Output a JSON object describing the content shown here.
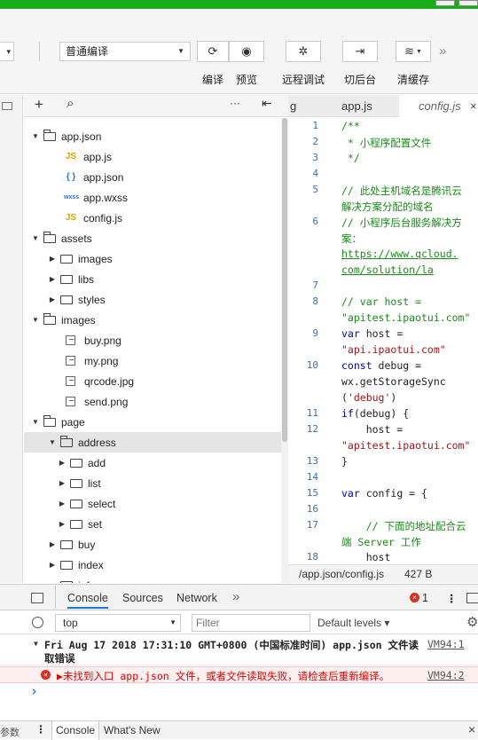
{
  "toolbar": {
    "compile_mode": "普通编译",
    "small_select": "▾",
    "buttons": [
      {
        "icon": "refresh-icon",
        "glyph": "⟳",
        "label": "编译"
      },
      {
        "icon": "eye-icon",
        "glyph": "◉",
        "label": "预览"
      },
      {
        "icon": "bug-icon",
        "glyph": "✲",
        "label": "远程调试"
      },
      {
        "icon": "background-icon",
        "glyph": "⇥",
        "label": "切后台"
      },
      {
        "icon": "layers-icon",
        "glyph": "≋",
        "label": "清缓存"
      }
    ],
    "more": "»"
  },
  "tree": {
    "toolbar": {
      "add": "+",
      "search": "⌕",
      "more": "···",
      "collapse": "⇤"
    },
    "items": [
      {
        "depth": 0,
        "type": "folder",
        "open": true,
        "label": "app.json"
      },
      {
        "depth": 1,
        "type": "js",
        "label": "app.js"
      },
      {
        "depth": 1,
        "type": "json",
        "label": "app.json"
      },
      {
        "depth": 1,
        "type": "wxss",
        "label": "app.wxss"
      },
      {
        "depth": 1,
        "type": "js",
        "label": "config.js"
      },
      {
        "depth": 0,
        "type": "folder",
        "open": true,
        "label": "assets"
      },
      {
        "depth": 1,
        "type": "folder",
        "open": false,
        "label": "images"
      },
      {
        "depth": 1,
        "type": "folder",
        "open": false,
        "label": "libs"
      },
      {
        "depth": 1,
        "type": "folder",
        "open": false,
        "label": "styles"
      },
      {
        "depth": 0,
        "type": "folder",
        "open": true,
        "label": "images"
      },
      {
        "depth": 1,
        "type": "img",
        "label": "buy.png"
      },
      {
        "depth": 1,
        "type": "img",
        "label": "my.png"
      },
      {
        "depth": 1,
        "type": "img",
        "label": "qrcode.jpg"
      },
      {
        "depth": 1,
        "type": "img",
        "label": "send.png"
      },
      {
        "depth": 0,
        "type": "folder",
        "open": true,
        "label": "page"
      },
      {
        "depth": 1,
        "type": "folder",
        "open": true,
        "label": "address",
        "selected": true
      },
      {
        "depth": 2,
        "type": "folder",
        "open": false,
        "label": "add"
      },
      {
        "depth": 2,
        "type": "folder",
        "open": false,
        "label": "list"
      },
      {
        "depth": 2,
        "type": "folder",
        "open": false,
        "label": "select"
      },
      {
        "depth": 2,
        "type": "folder",
        "open": false,
        "label": "set"
      },
      {
        "depth": 1,
        "type": "folder",
        "open": false,
        "label": "buy"
      },
      {
        "depth": 1,
        "type": "folder",
        "open": false,
        "label": "index"
      },
      {
        "depth": 1,
        "type": "folder",
        "open": false,
        "label": "info"
      }
    ]
  },
  "editor": {
    "tabs": [
      {
        "label": "g",
        "active": false
      },
      {
        "label": "app.js",
        "active": false
      },
      {
        "label": "config.js",
        "active": true
      }
    ],
    "close": "×",
    "lines": [
      {
        "n": "1",
        "parts": [
          {
            "c": "cm",
            "t": "/**"
          }
        ]
      },
      {
        "n": "2",
        "parts": [
          {
            "c": "cm",
            "t": " * 小程序配置文件"
          }
        ]
      },
      {
        "n": "3",
        "parts": [
          {
            "c": "cm",
            "t": " */"
          }
        ]
      },
      {
        "n": "4",
        "parts": []
      },
      {
        "n": "5",
        "parts": [
          {
            "c": "cm",
            "t": "// 此处主机域名是腾讯云"
          }
        ]
      },
      {
        "n": "",
        "parts": [
          {
            "c": "cm",
            "t": "解决方案分配的域名"
          }
        ]
      },
      {
        "n": "6",
        "parts": [
          {
            "c": "cm",
            "t": "// 小程序后台服务解决方"
          }
        ]
      },
      {
        "n": "",
        "parts": [
          {
            "c": "cm",
            "t": "案："
          }
        ]
      },
      {
        "n": "",
        "parts": [
          {
            "c": "ul",
            "t": "https://www.qcloud."
          }
        ]
      },
      {
        "n": "",
        "parts": [
          {
            "c": "ul",
            "t": "com/solution/la"
          }
        ]
      },
      {
        "n": "7",
        "parts": []
      },
      {
        "n": "8",
        "parts": [
          {
            "c": "cm",
            "t": "// var host ="
          }
        ]
      },
      {
        "n": "",
        "parts": [
          {
            "c": "cm",
            "t": "\"apitest.ipaotui.com\""
          }
        ]
      },
      {
        "n": "9",
        "parts": [
          {
            "c": "kw",
            "t": "var"
          },
          {
            "c": "",
            "t": " host ="
          }
        ]
      },
      {
        "n": "",
        "parts": [
          {
            "c": "st",
            "t": "\"api.ipaotui.com\""
          }
        ]
      },
      {
        "n": "10",
        "parts": [
          {
            "c": "kw",
            "t": "const"
          },
          {
            "c": "",
            "t": " debug ="
          }
        ]
      },
      {
        "n": "",
        "parts": [
          {
            "c": "",
            "t": "wx.getStorageSync"
          }
        ]
      },
      {
        "n": "",
        "parts": [
          {
            "c": "",
            "t": "("
          },
          {
            "c": "st",
            "t": "'debug'"
          },
          {
            "c": "",
            "t": ")"
          }
        ]
      },
      {
        "n": "11",
        "parts": [
          {
            "c": "kw",
            "t": "if"
          },
          {
            "c": "",
            "t": "(debug) {"
          }
        ]
      },
      {
        "n": "12",
        "parts": [
          {
            "c": "",
            "t": "    host ="
          }
        ]
      },
      {
        "n": "",
        "parts": [
          {
            "c": "st",
            "t": "\"apitest.ipaotui.com\""
          }
        ]
      },
      {
        "n": "13",
        "parts": [
          {
            "c": "",
            "t": "}"
          }
        ]
      },
      {
        "n": "14",
        "parts": []
      },
      {
        "n": "15",
        "parts": [
          {
            "c": "kw",
            "t": "var"
          },
          {
            "c": "",
            "t": " config = {"
          }
        ]
      },
      {
        "n": "16",
        "parts": []
      },
      {
        "n": "17",
        "parts": [
          {
            "c": "cm",
            "t": "    // 下面的地址配合云"
          }
        ]
      },
      {
        "n": "",
        "parts": [
          {
            "c": "cm",
            "t": "端 Server 工作"
          }
        ]
      },
      {
        "n": "18",
        "parts": [
          {
            "c": "",
            "t": "    host"
          }
        ]
      }
    ],
    "status_path": "/app.json/config.js",
    "status_size": "427 B"
  },
  "devtools": {
    "tabs": [
      "Console",
      "Sources",
      "Network"
    ],
    "active_tab": "Console",
    "more": "»",
    "error_count": "1",
    "context": "top",
    "filter_placeholder": "Filter",
    "levels": "Default levels ▾",
    "messages": [
      {
        "type": "group",
        "text": "Fri Aug 17 2018 17:31:10 GMT+0800 (中国标准时间)  app.json 文件读",
        "text2": "取错误",
        "source": "VM94:1"
      },
      {
        "type": "error",
        "text": "▶未找到入口 app.json 文件，或者文件读取失败，请检查后重新编译。",
        "source": "VM94:2"
      }
    ],
    "prompt": "›",
    "drawer_left": "参数",
    "drawer_tabs": [
      "Console",
      "What's New"
    ],
    "drawer_close": "×"
  }
}
